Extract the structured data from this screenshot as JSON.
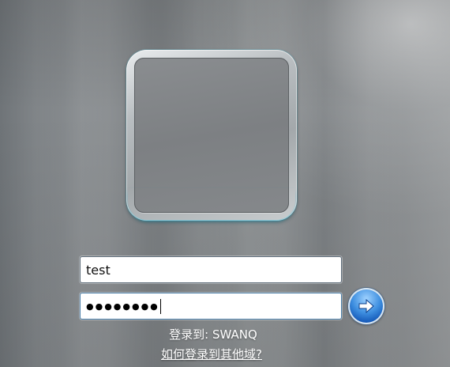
{
  "user_tile": {
    "icon": "user-picture-frame-icon"
  },
  "login": {
    "username_value": "test",
    "password_masked": "●●●●●●●●",
    "submit_icon": "arrow-right-icon"
  },
  "domain": {
    "logon_to": "登录到: SWANQ",
    "other_domain_link": "如何登录到其他域?"
  },
  "colors": {
    "submit_button": "#3e8fe0",
    "tile_glow": "#28aac8"
  }
}
